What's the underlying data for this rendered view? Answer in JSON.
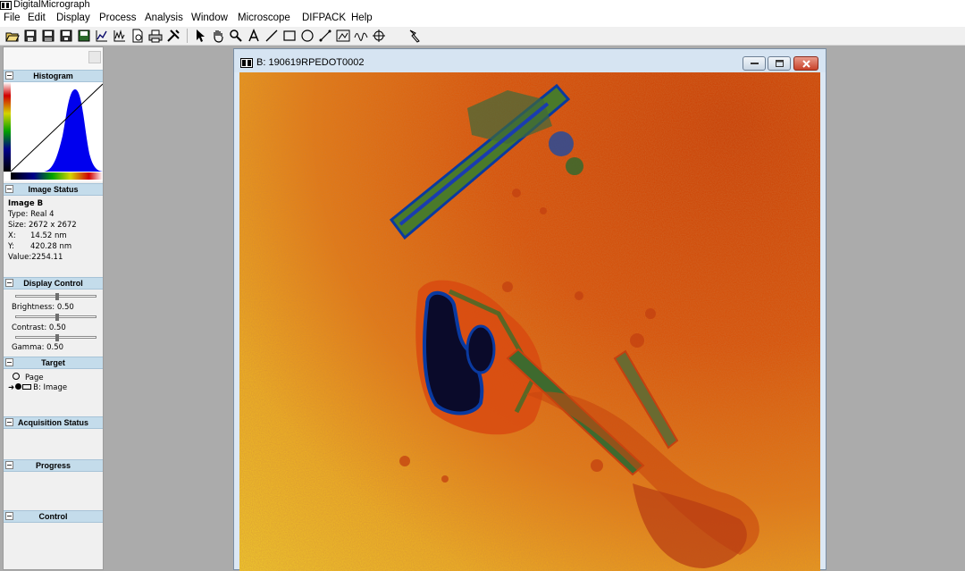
{
  "app": {
    "title": "DigitalMicrograph"
  },
  "menu": [
    "File",
    "Edit",
    "Display",
    "Process",
    "Analysis",
    "Window",
    "Microscope",
    "DIFPACK",
    "Help"
  ],
  "toolbar": {
    "file_tools": [
      "open-icon",
      "save-icon",
      "save-all-icon",
      "save-display-icon",
      "save-as-icon",
      "plot-icon",
      "line-plot-icon",
      "page-setup-icon",
      "print-icon",
      "tools-icon"
    ],
    "drawing_tools": [
      "pointer-icon",
      "hand-icon",
      "zoom-icon",
      "text-icon",
      "line-icon",
      "rectangle-icon",
      "oval-icon",
      "roi-icon",
      "rotate-icon",
      "profile-icon",
      "crosshair-icon",
      "wand-icon"
    ]
  },
  "panel": {
    "histogram": {
      "title": "Histogram"
    },
    "image_status": {
      "title": "Image Status",
      "name": "Image B",
      "type_label": "Type:",
      "type_value": "Real 4",
      "size_label": "Size:",
      "size_value": "2672 x 2672",
      "x_label": "X:",
      "x_value": "14.52 nm",
      "y_label": "Y:",
      "y_value": "420.28 nm",
      "value_label": "Value:",
      "value_value": "2254.11"
    },
    "display_control": {
      "title": "Display Control",
      "brightness": "Brightness: 0.50",
      "brightness_level": 0.5,
      "contrast": "Contrast: 0.50",
      "contrast_level": 0.5,
      "gamma": "Gamma: 0.50",
      "gamma_level": 0.5
    },
    "target": {
      "title": "Target",
      "page_label": "Page",
      "image_label": "B: Image"
    },
    "acquisition_status": {
      "title": "Acquisition Status"
    },
    "progress": {
      "title": "Progress"
    },
    "control": {
      "title": "Control"
    }
  },
  "image_window": {
    "title": "B: 190619RPEDOT0002",
    "buttons": [
      "minimize-icon",
      "maximize-icon",
      "close-icon"
    ]
  }
}
